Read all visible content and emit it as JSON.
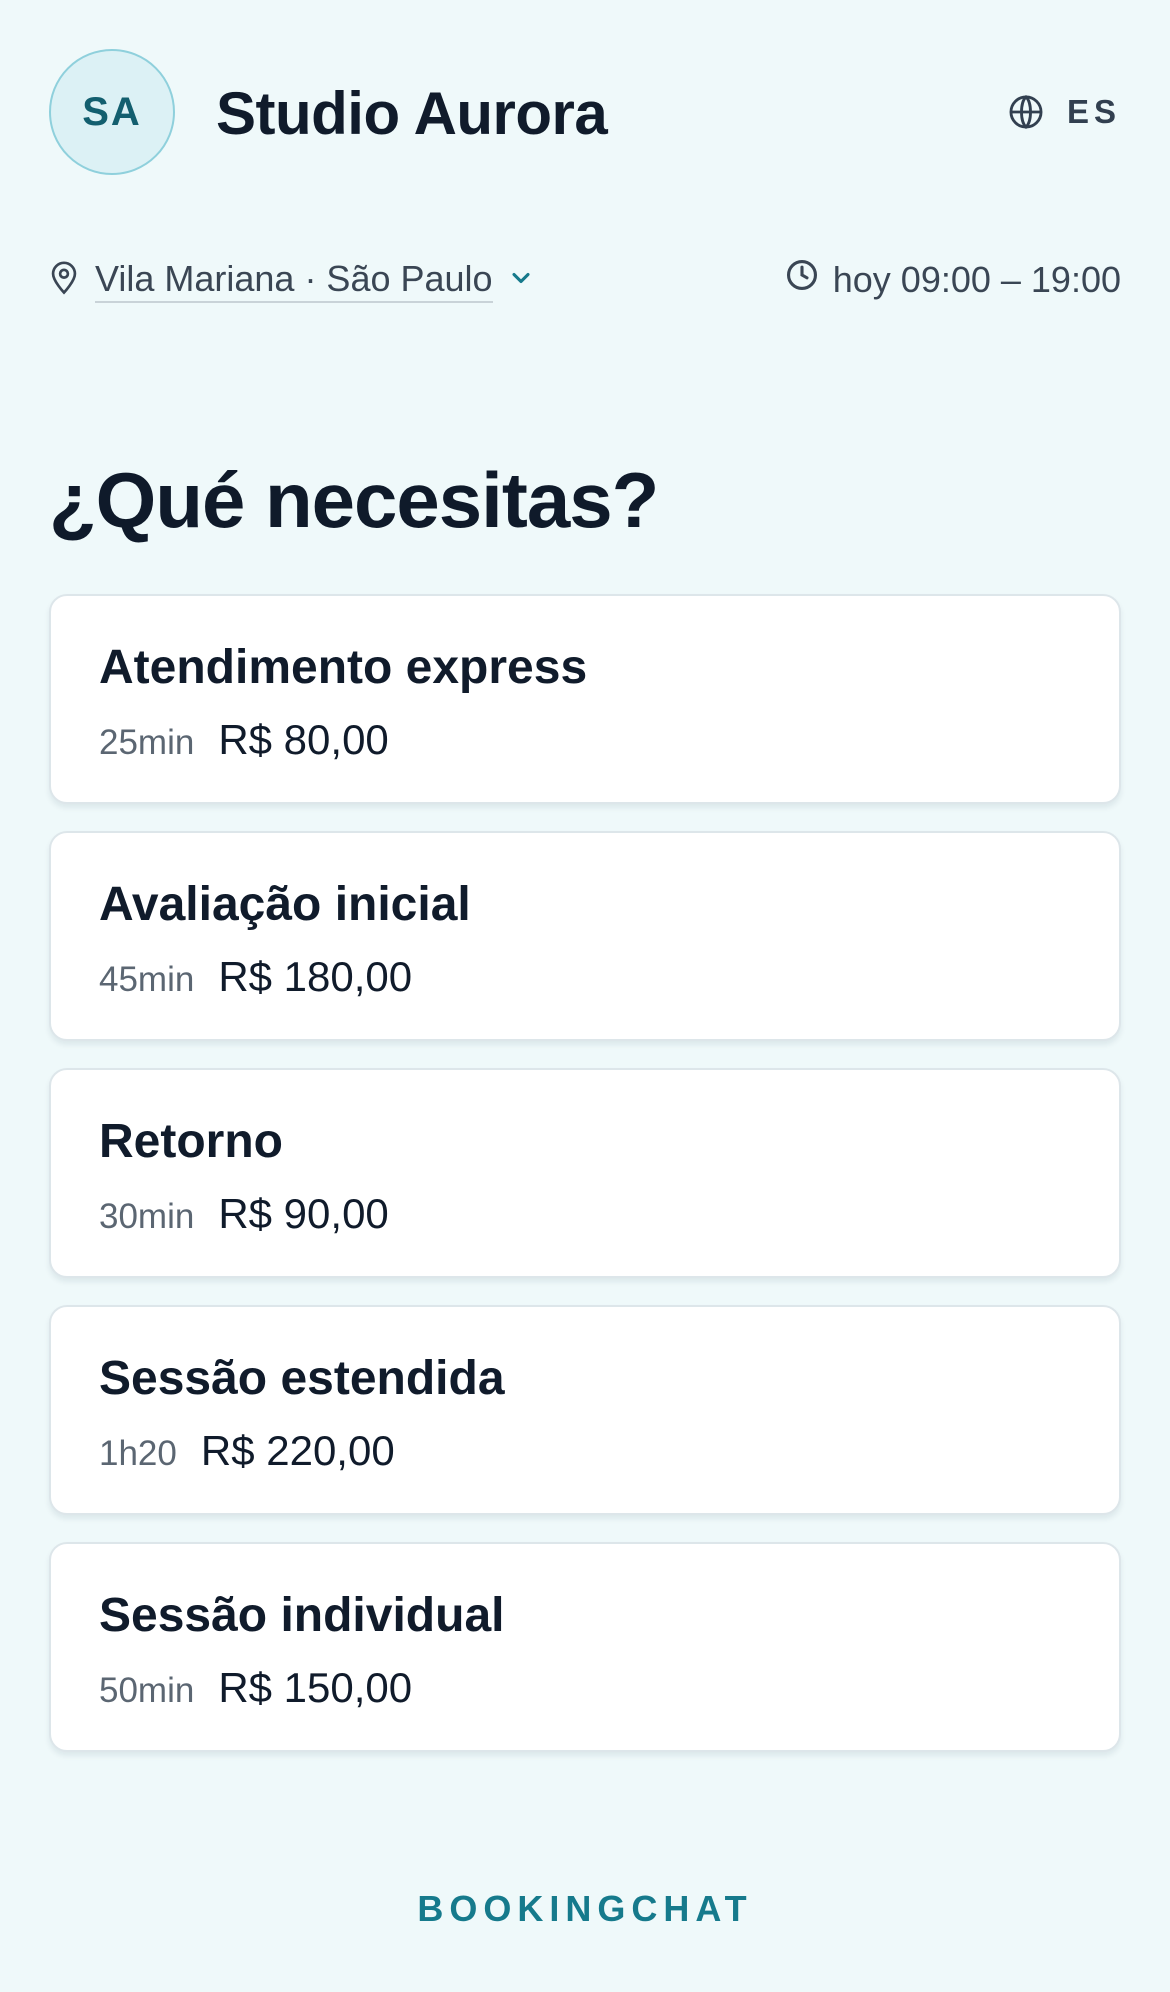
{
  "business": {
    "initials": "SA",
    "name": "Studio Aurora"
  },
  "language": {
    "code": "ES",
    "icon": "globe-icon"
  },
  "location": {
    "label": "Vila Mariana · São Paulo",
    "icon": "map-pin-icon",
    "dropdown_icon": "chevron-down-icon"
  },
  "hours": {
    "label": "hoy 09:00 – 19:00",
    "icon": "clock-icon"
  },
  "section": {
    "title": "¿Qué necesitas?"
  },
  "services": [
    {
      "name": "Atendimento express",
      "duration": "25min",
      "price": "R$ 80,00"
    },
    {
      "name": "Avaliação inicial",
      "duration": "45min",
      "price": "R$ 180,00"
    },
    {
      "name": "Retorno",
      "duration": "30min",
      "price": "R$ 90,00"
    },
    {
      "name": "Sessão estendida",
      "duration": "1h20",
      "price": "R$ 220,00"
    },
    {
      "name": "Sessão individual",
      "duration": "50min",
      "price": "R$ 150,00"
    }
  ],
  "footer": {
    "brand": "BOOKINGCHAT"
  },
  "colors": {
    "background": "#eff9fa",
    "accent": "#167a8c",
    "avatar_bg": "#dcf1f5",
    "avatar_border": "#8fd0dc",
    "text_primary": "#101b2b",
    "text_secondary": "#5b6672"
  }
}
